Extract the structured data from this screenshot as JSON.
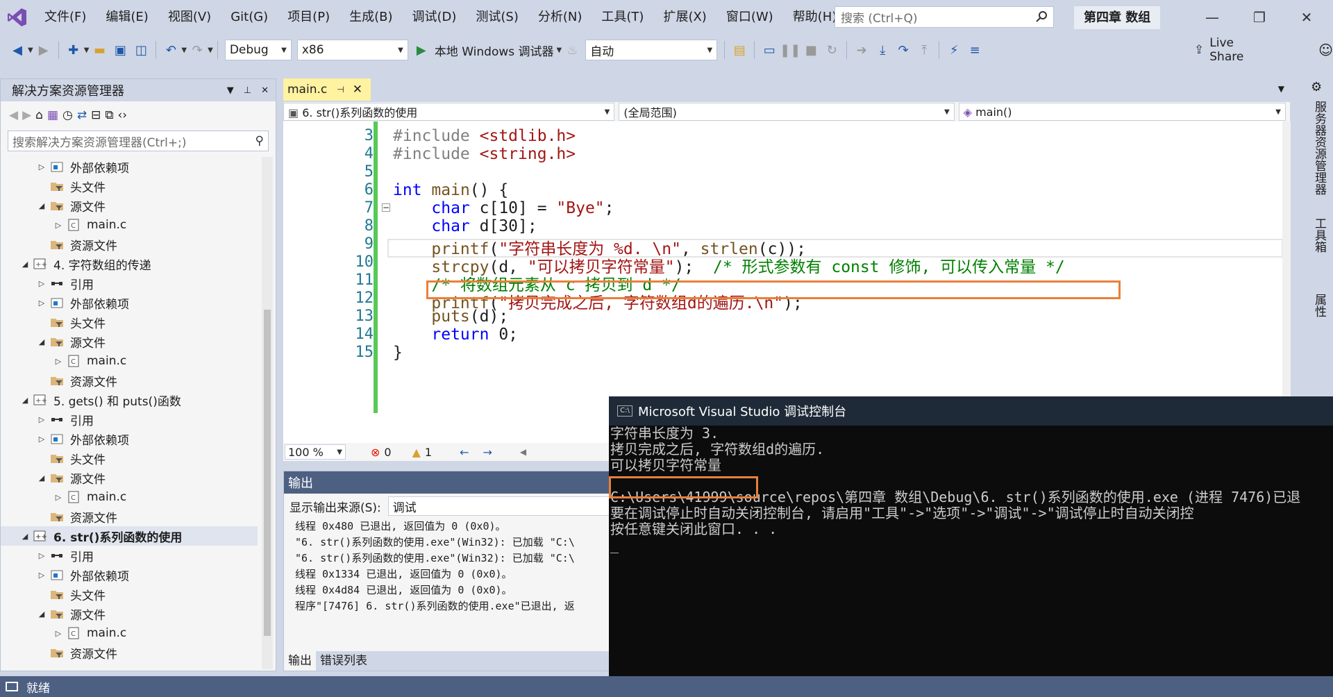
{
  "menubar": {
    "items": [
      "文件(F)",
      "编辑(E)",
      "视图(V)",
      "Git(G)",
      "项目(P)",
      "生成(B)",
      "调试(D)",
      "测试(S)",
      "分析(N)",
      "工具(T)",
      "扩展(X)",
      "窗口(W)",
      "帮助(H)"
    ],
    "search_placeholder": "搜索 (Ctrl+Q)",
    "solution_title": "第四章 数组"
  },
  "toolbar": {
    "config": "Debug",
    "platform": "x86",
    "run_label": "本地 Windows 调试器",
    "auto_label": "自动",
    "live_share": "Live Share"
  },
  "solution_explorer": {
    "title": "解决方案资源管理器",
    "search_placeholder": "搜索解决方案资源管理器(Ctrl+;)",
    "rows": [
      {
        "label": "外部依赖项",
        "arrow": "▷",
        "icon": "external-deps-icon",
        "indent": 1
      },
      {
        "label": "头文件",
        "arrow": "",
        "icon": "filter-folder-icon",
        "indent": 1
      },
      {
        "label": "源文件",
        "arrow": "◢",
        "icon": "filter-folder-icon",
        "indent": 1
      },
      {
        "label": "main.c",
        "arrow": "▷",
        "icon": "c-file-icon",
        "indent": 2
      },
      {
        "label": "资源文件",
        "arrow": "",
        "icon": "filter-folder-icon",
        "indent": 1
      },
      {
        "label": "4. 字符数组的传递",
        "arrow": "◢",
        "icon": "project-icon",
        "indent": 0
      },
      {
        "label": "引用",
        "arrow": "▷",
        "icon": "references-icon",
        "indent": 1
      },
      {
        "label": "外部依赖项",
        "arrow": "▷",
        "icon": "external-deps-icon",
        "indent": 1
      },
      {
        "label": "头文件",
        "arrow": "",
        "icon": "filter-folder-icon",
        "indent": 1
      },
      {
        "label": "源文件",
        "arrow": "◢",
        "icon": "filter-folder-icon",
        "indent": 1
      },
      {
        "label": "main.c",
        "arrow": "▷",
        "icon": "c-file-icon",
        "indent": 2
      },
      {
        "label": "资源文件",
        "arrow": "",
        "icon": "filter-folder-icon",
        "indent": 1
      },
      {
        "label": "5. gets() 和 puts()函数",
        "arrow": "◢",
        "icon": "project-icon",
        "indent": 0
      },
      {
        "label": "引用",
        "arrow": "▷",
        "icon": "references-icon",
        "indent": 1
      },
      {
        "label": "外部依赖项",
        "arrow": "▷",
        "icon": "external-deps-icon",
        "indent": 1
      },
      {
        "label": "头文件",
        "arrow": "",
        "icon": "filter-folder-icon",
        "indent": 1
      },
      {
        "label": "源文件",
        "arrow": "◢",
        "icon": "filter-folder-icon",
        "indent": 1
      },
      {
        "label": "main.c",
        "arrow": "▷",
        "icon": "c-file-icon",
        "indent": 2
      },
      {
        "label": "资源文件",
        "arrow": "",
        "icon": "filter-folder-icon",
        "indent": 1
      },
      {
        "label": "6. str()系列函数的使用",
        "arrow": "◢",
        "icon": "project-icon",
        "indent": 0,
        "selected": true
      },
      {
        "label": "引用",
        "arrow": "▷",
        "icon": "references-icon",
        "indent": 1
      },
      {
        "label": "外部依赖项",
        "arrow": "▷",
        "icon": "external-deps-icon",
        "indent": 1
      },
      {
        "label": "头文件",
        "arrow": "",
        "icon": "filter-folder-icon",
        "indent": 1
      },
      {
        "label": "源文件",
        "arrow": "◢",
        "icon": "filter-folder-icon",
        "indent": 1
      },
      {
        "label": "main.c",
        "arrow": "▷",
        "icon": "c-file-icon",
        "indent": 2
      },
      {
        "label": "资源文件",
        "arrow": "",
        "icon": "filter-folder-icon",
        "indent": 1
      }
    ]
  },
  "editor": {
    "tab_label": "main.c",
    "nav_project": "6. str()系列函数的使用",
    "nav_scope": "(全局范围)",
    "nav_function": "main()",
    "zoom": "100 %",
    "errors": "0",
    "warnings": "1",
    "lines": [
      {
        "num": "3",
        "html": "<span class='pp'>#include</span> <span class='inc'>&lt;stdlib.h&gt;</span>"
      },
      {
        "num": "4",
        "html": "<span class='pp'>#include</span> <span class='inc'>&lt;string.h&gt;</span>"
      },
      {
        "num": "5",
        "html": ""
      },
      {
        "num": "6",
        "html": "<span class='kw'>int</span> <span class='fn'>main</span>() {"
      },
      {
        "num": "7",
        "html": "    <span class='kw'>char</span> c[10] = <span class='str'>\"Bye\"</span>;"
      },
      {
        "num": "8",
        "html": "    <span class='kw'>char</span> d[30];"
      },
      {
        "num": "9",
        "html": "    <span class='fn'>printf</span>(<span class='str'>\"字符串长度为 %d. \\n\"</span>, <span class='fn'>strlen</span>(c));"
      },
      {
        "num": "10",
        "html": "    <span class='fn'>strcpy</span>(d, <span class='str'>\"可以拷贝字符常量\"</span>);  <span class='cmt'>/* 形式参数有 const 修饰, 可以传入常量 */</span>"
      },
      {
        "num": "11",
        "html": "    <span class='cmt'>/* 将数组元素从 c 拷贝到 d */</span>"
      },
      {
        "num": "12",
        "html": "    <span class='fn'>printf</span>(<span class='str'>\"拷贝完成之后, 字符数组d的遍历.\\n\"</span>);"
      },
      {
        "num": "13",
        "html": "    <span class='fn'>puts</span>(d);"
      },
      {
        "num": "14",
        "html": "    <span class='kw'>return</span> 0;"
      },
      {
        "num": "15",
        "html": "}"
      }
    ]
  },
  "output": {
    "title": "输出",
    "source_label": "显示输出来源(S):",
    "source_value": "调试",
    "lines": [
      "线程 0x480 已退出, 返回值为 0 (0x0)。",
      "\"6. str()系列函数的使用.exe\"(Win32): 已加载 \"C:\\",
      "\"6. str()系列函数的使用.exe\"(Win32): 已加载 \"C:\\",
      "线程 0x1334 已退出, 返回值为 0 (0x0)。",
      "线程 0x4d84 已退出, 返回值为 0 (0x0)。",
      "程序\"[7476] 6. str()系列函数的使用.exe\"已退出, 返"
    ],
    "tabs": [
      "输出",
      "错误列表"
    ]
  },
  "right_strip": {
    "items": [
      "服务器资源管理器",
      "工具箱",
      "属性"
    ]
  },
  "console": {
    "title": "Microsoft Visual Studio 调试控制台",
    "lines": [
      "字符串长度为 3.",
      "拷贝完成之后, 字符数组d的遍历.",
      "可以拷贝字符常量",
      "",
      "C:\\Users\\41999\\source\\repos\\第四章 数组\\Debug\\6. str()系列函数的使用.exe (进程 7476)已退",
      "要在调试停止时自动关闭控制台, 请启用\"工具\"->\"选项\"->\"调试\"->\"调试停止时自动关闭控",
      "按任意键关闭此窗口. . .",
      "_"
    ]
  },
  "status": {
    "text": "就绪"
  },
  "colors": {
    "accent": "#4d6082",
    "highlight_box": "#e8803a",
    "vs_purple": "#68217a"
  }
}
